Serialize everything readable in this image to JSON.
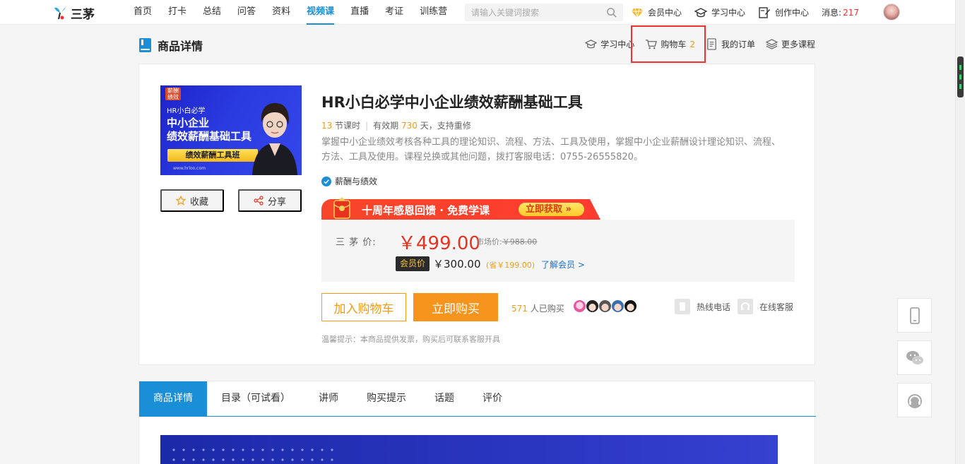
{
  "header": {
    "logo_text": "三茅",
    "nav": [
      "首页",
      "打卡",
      "总结",
      "问答",
      "资料",
      "视频课",
      "直播",
      "考证",
      "训练营"
    ],
    "active_nav": "视频课",
    "search_placeholder": "请输入关键词搜索",
    "links": [
      "会员中心",
      "学习中心",
      "创作中心"
    ],
    "message_label": "消息:",
    "message_count": "217"
  },
  "page": {
    "title": "商品详情",
    "head_links": {
      "study": "学习中心",
      "cart": "购物车",
      "cart_count": "2",
      "orders": "我的订单",
      "more": "更多课程"
    }
  },
  "course": {
    "cover": {
      "tag": "薪酬绩效",
      "subtitle": "HR小白必学",
      "line1": "中小企业",
      "line2": "绩效薪酬基础工具",
      "ribbon": "绩效薪酬工具班",
      "url": "www.hrloo.com"
    },
    "favorite_label": "收藏",
    "share_label": "分享",
    "title": "HR小白必学中小企业绩效薪酬基础工具",
    "lessons": "13",
    "lessons_unit": "节课时",
    "validity_prefix": "有效期",
    "validity_days": "730",
    "validity_suffix": "天，支持重修",
    "description": "掌握中小企业绩效考核各种工具的理论知识、流程、方法、工具及使用，掌握中小企业薪酬设计理论知识、流程、方法、工具及使用。课程兑换或其他问题，拨打客服电话：0755-26555820。",
    "category": "薪酬与绩效",
    "promo_text": "十周年感恩回馈 · 免费学课",
    "promo_button": "立即获取 »",
    "price_label": "三 茅 价:",
    "price": "￥499.00",
    "market_label": "市场价:",
    "market_price": "￥988.00",
    "vip_label": "会员价",
    "vip_price": "￥300.00",
    "vip_save": "(省￥199.00)",
    "vip_link": "了解会员 >",
    "add_cart": "加入购物车",
    "buy_now": "立即购买",
    "buyers_count": "571",
    "buyers_text": "人已购买",
    "hotline": "热线电话",
    "online_service": "在线客服",
    "tip": "温馨提示：本商品提供发票，购买后可联系客服开具"
  },
  "tabs": [
    "商品详情",
    "目录（可试看）",
    "讲师",
    "购买提示",
    "话题",
    "评价"
  ],
  "colors": {
    "brand_blue": "#1a8fd8",
    "price_red": "#e8321f",
    "orange": "#f7941d",
    "highlight": "#e33333"
  },
  "icons": {
    "search": "search-icon",
    "member": "diamond-icon",
    "study": "graduation-cap-icon",
    "create": "edit-icon",
    "cart": "cart-icon",
    "orders": "document-icon",
    "more": "layers-icon",
    "favorite": "star-icon",
    "share": "share-icon",
    "phone": "phone-icon",
    "wechat": "wechat-icon",
    "headset": "headset-icon"
  }
}
